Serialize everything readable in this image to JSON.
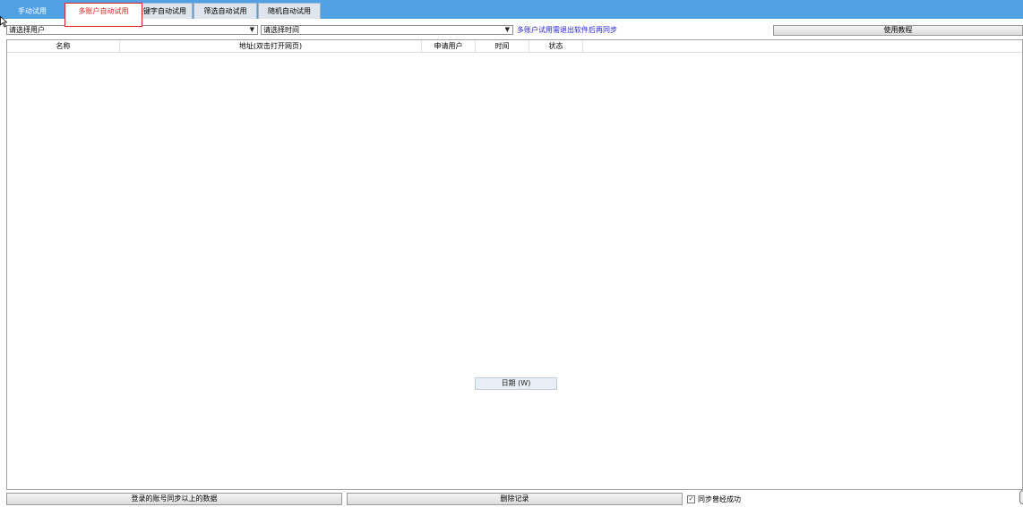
{
  "tabs": [
    {
      "label": "手动试用"
    },
    {
      "label": "多账户自动试用"
    },
    {
      "label": "关键字自动试用"
    },
    {
      "label": "筛选自动试用"
    },
    {
      "label": "随机自动试用"
    }
  ],
  "active_tab": "多账户自动试用",
  "toolbar": {
    "user_select": "请选择用户",
    "time_select": "请选择时间",
    "hint": "多账户试用需退出软件后再同步",
    "tutorial_button": "使用教程"
  },
  "table": {
    "columns": [
      "名称",
      "地址(双击打开网页)",
      "申请用户",
      "时间",
      "状态"
    ],
    "rows": []
  },
  "date_label": "日期 (W)",
  "footer": {
    "sync_button": "登录的账号同步以上的数据",
    "delete_button": "删除记录",
    "sync_checkbox_label": "同步曾经成功",
    "sync_checkbox_checked": true
  },
  "colors": {
    "titlebar": "#4fa1e4",
    "active_tab_text": "#e02020",
    "hint_text": "#2424d8"
  }
}
